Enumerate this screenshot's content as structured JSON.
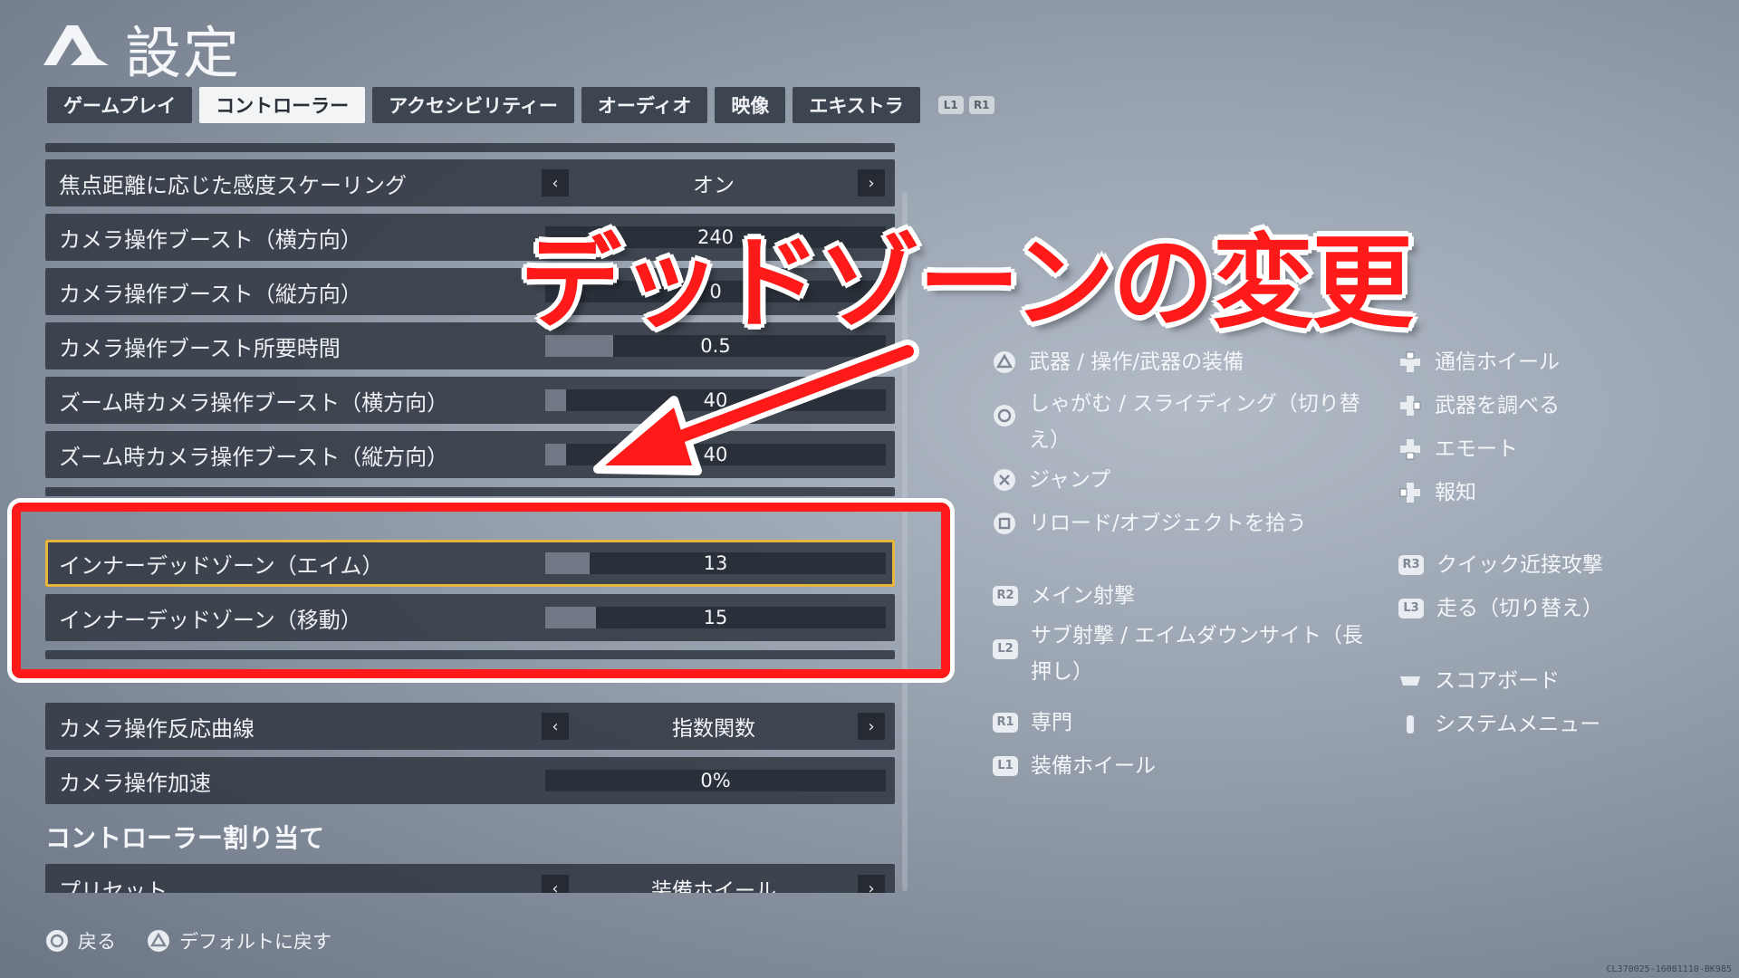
{
  "header": {
    "title": "設定"
  },
  "tabs": [
    {
      "label": "ゲームプレイ",
      "active": false
    },
    {
      "label": "コントローラー",
      "active": true
    },
    {
      "label": "アクセシビリティー",
      "active": false
    },
    {
      "label": "オーディオ",
      "active": false
    },
    {
      "label": "映像",
      "active": false
    },
    {
      "label": "エキストラ",
      "active": false
    }
  ],
  "bumpers": [
    "L1",
    "R1"
  ],
  "settings": {
    "focal_scaling": {
      "label": "焦点距離に応じた感度スケーリング",
      "value": "オン"
    },
    "boost_h": {
      "label": "カメラ操作ブースト（横方向）",
      "value": "240"
    },
    "boost_v": {
      "label": "カメラ操作ブースト（縦方向）",
      "value": "0"
    },
    "boost_time": {
      "label": "カメラ操作ブースト所要時間",
      "value": "0.5",
      "fill": 0.2
    },
    "zoom_boost_h": {
      "label": "ズーム時カメラ操作ブースト（横方向）",
      "value": "40",
      "fill": 0.06
    },
    "zoom_boost_v": {
      "label": "ズーム時カメラ操作ブースト（縦方向）",
      "value": "40",
      "fill": 0.06
    },
    "deadzone_aim": {
      "label": "インナーデッドゾーン（エイム）",
      "value": "13",
      "fill": 0.13
    },
    "deadzone_move": {
      "label": "インナーデッドゾーン（移動）",
      "value": "15",
      "fill": 0.15
    },
    "response_curve": {
      "label": "カメラ操作反応曲線",
      "value": "指数関数"
    },
    "acceleration": {
      "label": "カメラ操作加速",
      "value": "0%",
      "fill": 0.0
    },
    "section_heading": "コントローラー割り当て",
    "preset": {
      "label": "プリセット",
      "value": "装備ホイール"
    }
  },
  "overlay": {
    "title": "デッドゾーンの変更"
  },
  "legend_left": [
    {
      "icon": "triangle",
      "text": "武器 / 操作/武器の装備"
    },
    {
      "icon": "circle",
      "text": "しゃがむ / スライディング（切り替え）"
    },
    {
      "icon": "cross",
      "text": "ジャンプ"
    },
    {
      "icon": "square",
      "text": "リロード/オブジェクトを拾う"
    },
    {
      "icon": "R2",
      "text": "メイン射撃"
    },
    {
      "icon": "L2",
      "text": "サブ射撃 / エイムダウンサイト（長押し）"
    },
    {
      "icon": "R1",
      "text": "専門"
    },
    {
      "icon": "L1",
      "text": "装備ホイール"
    }
  ],
  "legend_right": [
    {
      "icon": "dpad-up",
      "text": "通信ホイール"
    },
    {
      "icon": "dpad-right",
      "text": "武器を調べる"
    },
    {
      "icon": "dpad-down",
      "text": "エモート"
    },
    {
      "icon": "dpad-left",
      "text": "報知"
    },
    {
      "icon": "R3",
      "text": "クイック近接攻撃"
    },
    {
      "icon": "L3",
      "text": "走る（切り替え）"
    },
    {
      "icon": "touchpad",
      "text": "スコアボード"
    },
    {
      "icon": "options",
      "text": "システムメニュー"
    }
  ],
  "footer": {
    "back": "戻る",
    "default": "デフォルトに戻す"
  },
  "build": "CL370025-16081110-BK985",
  "colors": {
    "highlight": "#ff1a1a",
    "focus": "#e5b53c",
    "row_bg": "#323943"
  }
}
